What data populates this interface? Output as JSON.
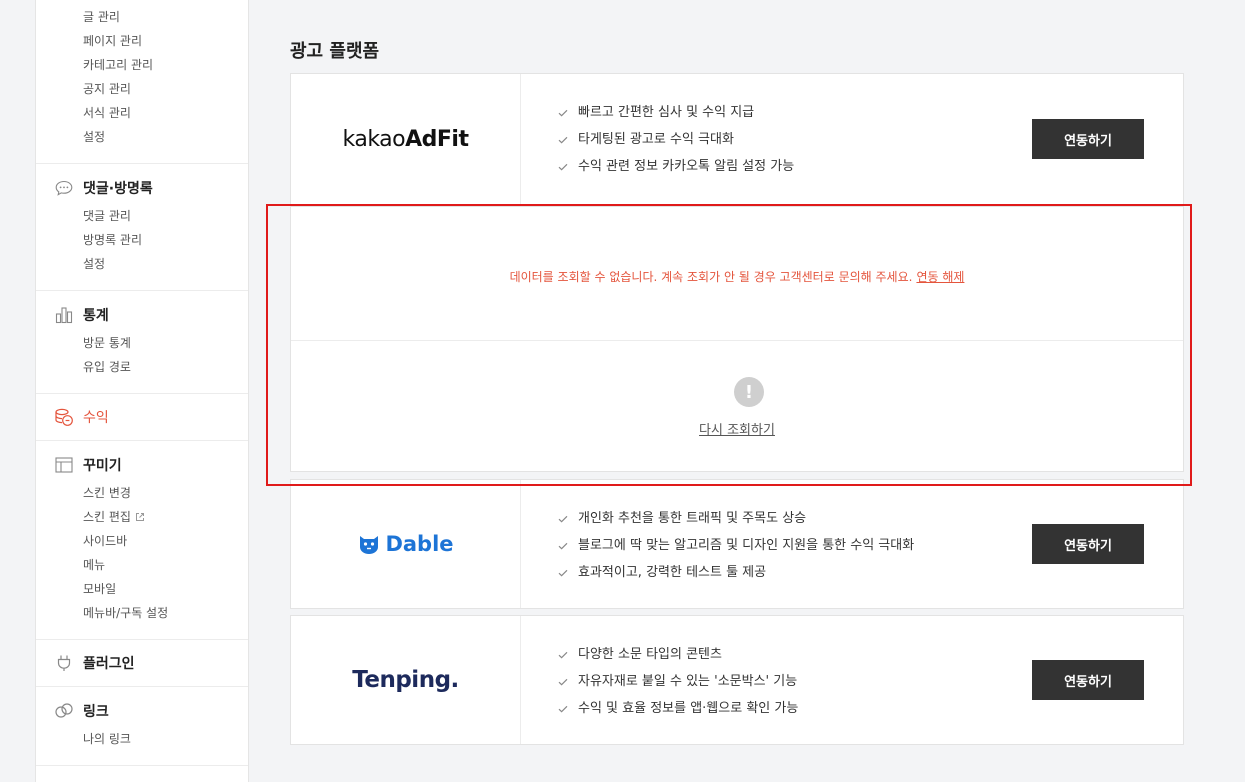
{
  "sidebar": {
    "post_group": {
      "items": [
        "글 관리",
        "페이지 관리",
        "카테고리 관리",
        "공지 관리",
        "서식 관리",
        "설정"
      ]
    },
    "comments": {
      "title": "댓글·방명록",
      "icon": "speech-bubble-icon",
      "items": [
        "댓글 관리",
        "방명록 관리",
        "설정"
      ]
    },
    "stats": {
      "title": "통계",
      "icon": "bar-chart-icon",
      "items": [
        "방문 통계",
        "유입 경로"
      ]
    },
    "revenue": {
      "title": "수익",
      "icon": "coins-icon",
      "active_color": "#e4553d"
    },
    "decorate": {
      "title": "꾸미기",
      "icon": "layout-icon",
      "items": [
        "스킨 변경",
        "스킨 편집",
        "사이드바",
        "메뉴",
        "모바일",
        "메뉴바/구독 설정"
      ]
    },
    "plugin": {
      "title": "플러그인",
      "icon": "plug-icon"
    },
    "link": {
      "title": "링크",
      "icon": "chain-link-icon",
      "items": [
        "나의 링크"
      ]
    }
  },
  "main": {
    "title": "광고 플랫폼",
    "platforms": [
      {
        "logo_text_light": "kakao",
        "logo_text_bold": "AdFit",
        "features": [
          "빠르고 간편한 심사 및 수익 지급",
          "타게팅된 광고로 수익 극대화",
          "수익 관련 정보 카카오톡 알림 설정 가능"
        ],
        "button": "연동하기"
      },
      {
        "logo_text": "Dable",
        "logo_color": "#1d74d6",
        "features": [
          "개인화 추천을 통한 트래픽 및 주목도 상승",
          "블로그에 딱 맞는 알고리즘 및 디자인 지원을 통한 수익 극대화",
          "효과적이고, 강력한 테스트 툴 제공"
        ],
        "button": "연동하기"
      },
      {
        "logo_text": "Tenping.",
        "logo_color": "#1d2a5c",
        "features": [
          "다양한 소문 타입의 콘텐츠",
          "자유자재로 붙일 수 있는 '소문박스' 기능",
          "수익 및 효율 정보를 앱·웹으로 확인 가능"
        ],
        "button": "연동하기"
      }
    ],
    "error": {
      "message": "데이터를 조회할 수 없습니다. 계속 조회가 안 될 경우 고객센터로 문의해 주세요.",
      "unlink": "연동 해제",
      "icon": "exclamation-circle-icon",
      "retry": "다시 조회하기",
      "color": "#e4553d"
    }
  },
  "colors": {
    "highlight": "#e01a1a",
    "button_bg": "#333333"
  }
}
